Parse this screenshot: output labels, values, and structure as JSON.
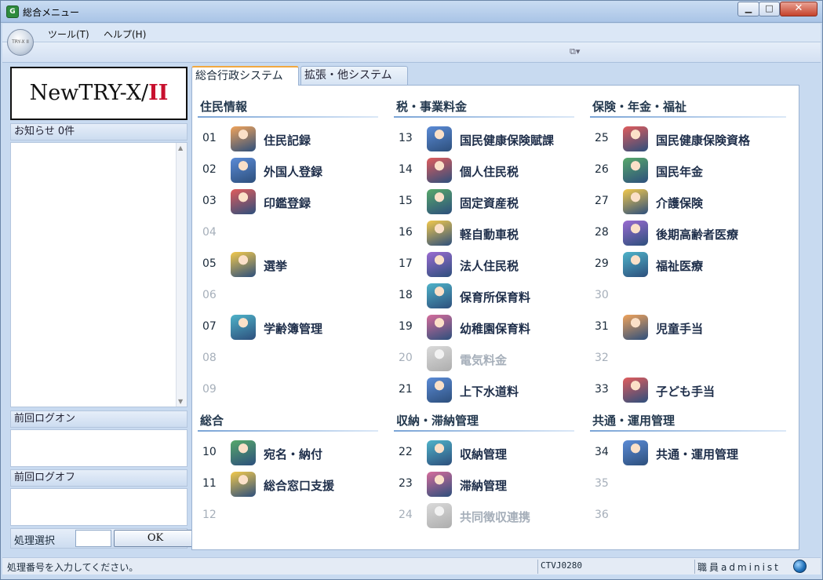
{
  "window": {
    "title": "総合メニュー",
    "app_icon": "G",
    "minimize": "▁",
    "maximize": "□",
    "close": "✕"
  },
  "menubar": {
    "items": [
      "ツール(T)",
      "ヘルプ(H)"
    ],
    "orb_label": "TRY-X II"
  },
  "toolbar": {
    "icon": "window-layout-icon",
    "glyph": "⧉▾"
  },
  "left": {
    "logo": {
      "main": "NewTRY-X/",
      "accent": "II"
    },
    "notice_label": "お知らせ 0件",
    "last_logon_label": "前回ログオン",
    "last_logoff_label": "前回ログオフ",
    "process_label": "処理選択",
    "ok_label": "OK"
  },
  "tabs": [
    {
      "label": "総合行政システム",
      "active": true
    },
    {
      "label": "拡張・他システム",
      "active": false
    }
  ],
  "sections": [
    {
      "title": "住民情報"
    },
    {
      "title": "税・事業料金"
    },
    {
      "title": "保険・年金・福祉"
    },
    {
      "title": "総合"
    },
    {
      "title": "収納・滞納管理"
    },
    {
      "title": "共通・運用管理"
    }
  ],
  "items": [
    {
      "num": "01",
      "label": "住民記録",
      "icon": "family-icon",
      "enabled": true
    },
    {
      "num": "02",
      "label": "外国人登録",
      "icon": "foreign-person-icon",
      "enabled": true
    },
    {
      "num": "03",
      "label": "印鑑登録",
      "icon": "seal-person-icon",
      "enabled": true
    },
    {
      "num": "04",
      "label": "",
      "icon": "",
      "enabled": false
    },
    {
      "num": "05",
      "label": "選挙",
      "icon": "voter-icon",
      "enabled": true
    },
    {
      "num": "06",
      "label": "",
      "icon": "",
      "enabled": false
    },
    {
      "num": "07",
      "label": "学齢簿管理",
      "icon": "students-icon",
      "enabled": true
    },
    {
      "num": "08",
      "label": "",
      "icon": "",
      "enabled": false
    },
    {
      "num": "09",
      "label": "",
      "icon": "",
      "enabled": false
    },
    {
      "num": "13",
      "label": "国民健康保険賦課",
      "icon": "health-insurance-icon",
      "enabled": true
    },
    {
      "num": "14",
      "label": "個人住民税",
      "icon": "couple-icon",
      "enabled": true
    },
    {
      "num": "15",
      "label": "固定資産税",
      "icon": "house-icon",
      "enabled": true
    },
    {
      "num": "16",
      "label": "軽自動車税",
      "icon": "car-icon",
      "enabled": true
    },
    {
      "num": "17",
      "label": "法人住民税",
      "icon": "building-icon",
      "enabled": true
    },
    {
      "num": "18",
      "label": "保育所保育料",
      "icon": "nursery-icon",
      "enabled": true
    },
    {
      "num": "19",
      "label": "幼稚園保育料",
      "icon": "kindergarten-icon",
      "enabled": true
    },
    {
      "num": "20",
      "label": "電気料金",
      "icon": "electricity-icon",
      "enabled": false
    },
    {
      "num": "21",
      "label": "上下水道料",
      "icon": "water-icon",
      "enabled": true
    },
    {
      "num": "25",
      "label": "国民健康保険資格",
      "icon": "insurance-card-icon",
      "enabled": true
    },
    {
      "num": "26",
      "label": "国民年金",
      "icon": "pension-icon",
      "enabled": true
    },
    {
      "num": "27",
      "label": "介護保険",
      "icon": "elderly-care-icon",
      "enabled": true
    },
    {
      "num": "28",
      "label": "後期高齢者医療",
      "icon": "elderly-medical-icon",
      "enabled": true
    },
    {
      "num": "29",
      "label": "福祉医療",
      "icon": "welfare-icon",
      "enabled": true
    },
    {
      "num": "30",
      "label": "",
      "icon": "",
      "enabled": false
    },
    {
      "num": "31",
      "label": "児童手当",
      "icon": "stroller-icon",
      "enabled": true
    },
    {
      "num": "32",
      "label": "",
      "icon": "",
      "enabled": false
    },
    {
      "num": "33",
      "label": "子ども手当",
      "icon": "parent-child-icon",
      "enabled": true
    },
    {
      "num": "10",
      "label": "宛名・納付",
      "icon": "address-book-icon",
      "enabled": true
    },
    {
      "num": "11",
      "label": "総合窓口支援",
      "icon": "counter-support-icon",
      "enabled": true
    },
    {
      "num": "12",
      "label": "",
      "icon": "",
      "enabled": false
    },
    {
      "num": "22",
      "label": "収納管理",
      "icon": "collection-icon",
      "enabled": true
    },
    {
      "num": "23",
      "label": "滞納管理",
      "icon": "arrears-icon",
      "enabled": true
    },
    {
      "num": "24",
      "label": "共同徴収連携",
      "icon": "joint-collection-icon",
      "enabled": false
    },
    {
      "num": "34",
      "label": "共通・運用管理",
      "icon": "toolbox-icon",
      "enabled": true
    },
    {
      "num": "35",
      "label": "",
      "icon": "",
      "enabled": false
    },
    {
      "num": "36",
      "label": "",
      "icon": "",
      "enabled": false
    }
  ],
  "status": {
    "message": "処理番号を入力してください。",
    "code": "CTVJ0280",
    "user": "職員administ"
  },
  "colors": {
    "accent_tab": "#f1a840",
    "close_red": "#c5432c",
    "logo_red": "#c8102e",
    "disabled": "#a6afba"
  }
}
